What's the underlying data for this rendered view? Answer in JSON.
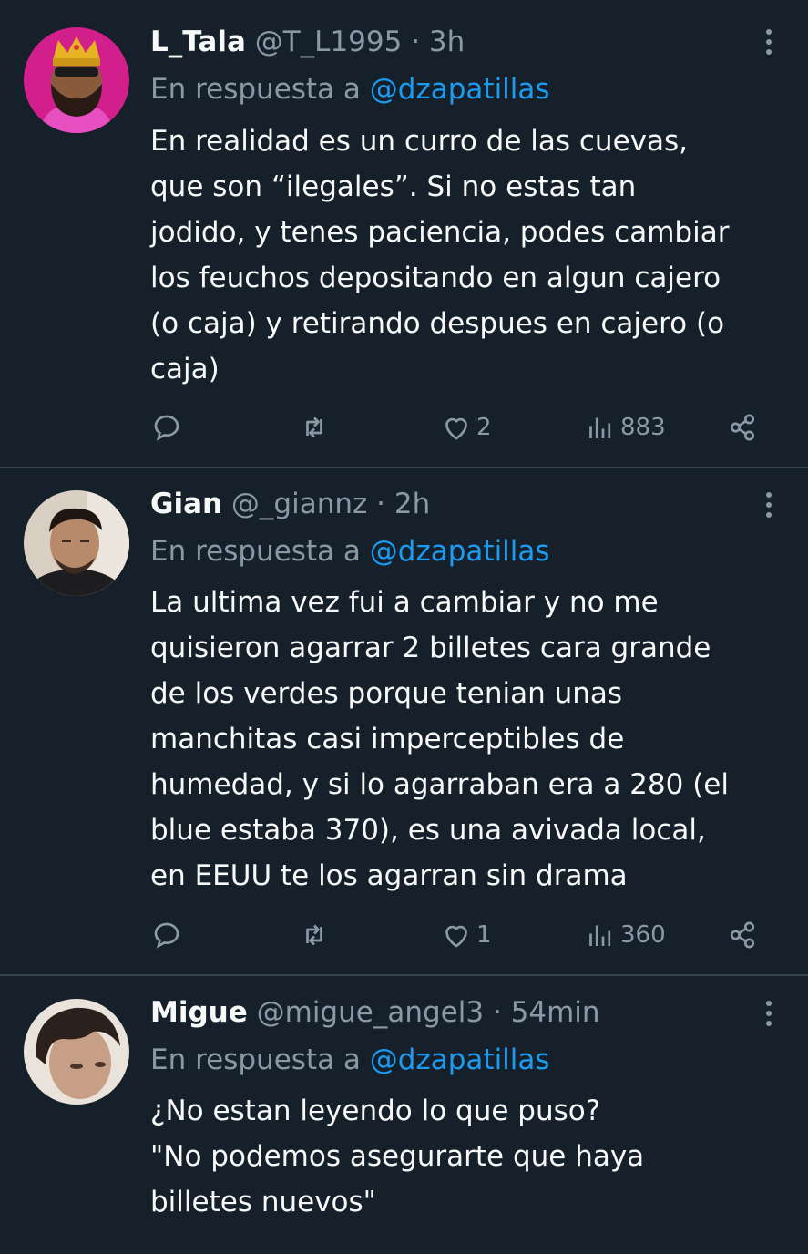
{
  "colors": {
    "background": "#15202b",
    "divider": "#38444d",
    "text": "#f7f9f9",
    "muted": "#8b98a5",
    "link": "#1d9bf0"
  },
  "replies": [
    {
      "name": "L_Tala",
      "handle": "@T_L1995",
      "sep": "·",
      "time": "3h",
      "reply_prefix": "En respuesta a",
      "reply_to": "@dzapatillas",
      "text": "En realidad es un curro de las cuevas,\nque son “ilegales”. Si no estas tan\njodido, y tenes paciencia, podes cambiar\nlos feuchos depositando en algun cajero\n(o caja) y retirando despues en cajero (o\ncaja)",
      "likes": "2",
      "views": "883"
    },
    {
      "name": "Gian",
      "handle": "@_giannz",
      "sep": "·",
      "time": "2h",
      "reply_prefix": "En respuesta a",
      "reply_to": "@dzapatillas",
      "text": "La ultima vez fui a cambiar y no me\nquisieron agarrar 2 billetes cara grande\nde los verdes porque tenian unas\nmanchitas casi imperceptibles de\nhumedad, y si lo agarraban era a 280 (el\nblue estaba 370), es una avivada local,\nen EEUU te los agarran sin drama",
      "likes": "1",
      "views": "360"
    },
    {
      "name": "Migue",
      "handle": "@migue_angel3",
      "sep": "·",
      "time": "54min",
      "reply_prefix": "En respuesta a",
      "reply_to": "@dzapatillas",
      "text": "¿No estan leyendo lo que puso?\n\"No podemos asegurarte que haya\nbilletes nuevos\""
    }
  ]
}
